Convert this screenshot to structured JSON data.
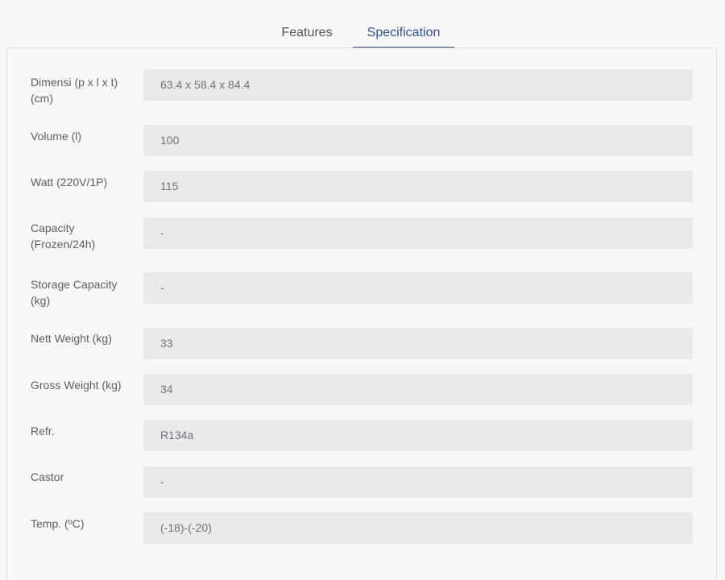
{
  "tabs": [
    {
      "label": "Features",
      "active": false
    },
    {
      "label": "Specification",
      "active": true
    }
  ],
  "accent_color": "#2f4f8f",
  "spec_rows": [
    {
      "label": "Dimensi (p x l x t) (cm)",
      "value": "63.4 x 58.4 x 84.4"
    },
    {
      "label": "Volume (l)",
      "value": "100"
    },
    {
      "label": "Watt (220V/1P)",
      "value": "115"
    },
    {
      "label": "Capacity (Frozen/24h)",
      "value": "-"
    },
    {
      "label": "Storage Capacity (kg)",
      "value": "-"
    },
    {
      "label": "Nett Weight (kg)",
      "value": "33"
    },
    {
      "label": "Gross Weight (kg)",
      "value": "34"
    },
    {
      "label": "Refr.",
      "value": "R134a"
    },
    {
      "label": "Castor",
      "value": "-"
    },
    {
      "label": "Temp. (ºC)",
      "value": "(-18)-(-20)"
    }
  ]
}
